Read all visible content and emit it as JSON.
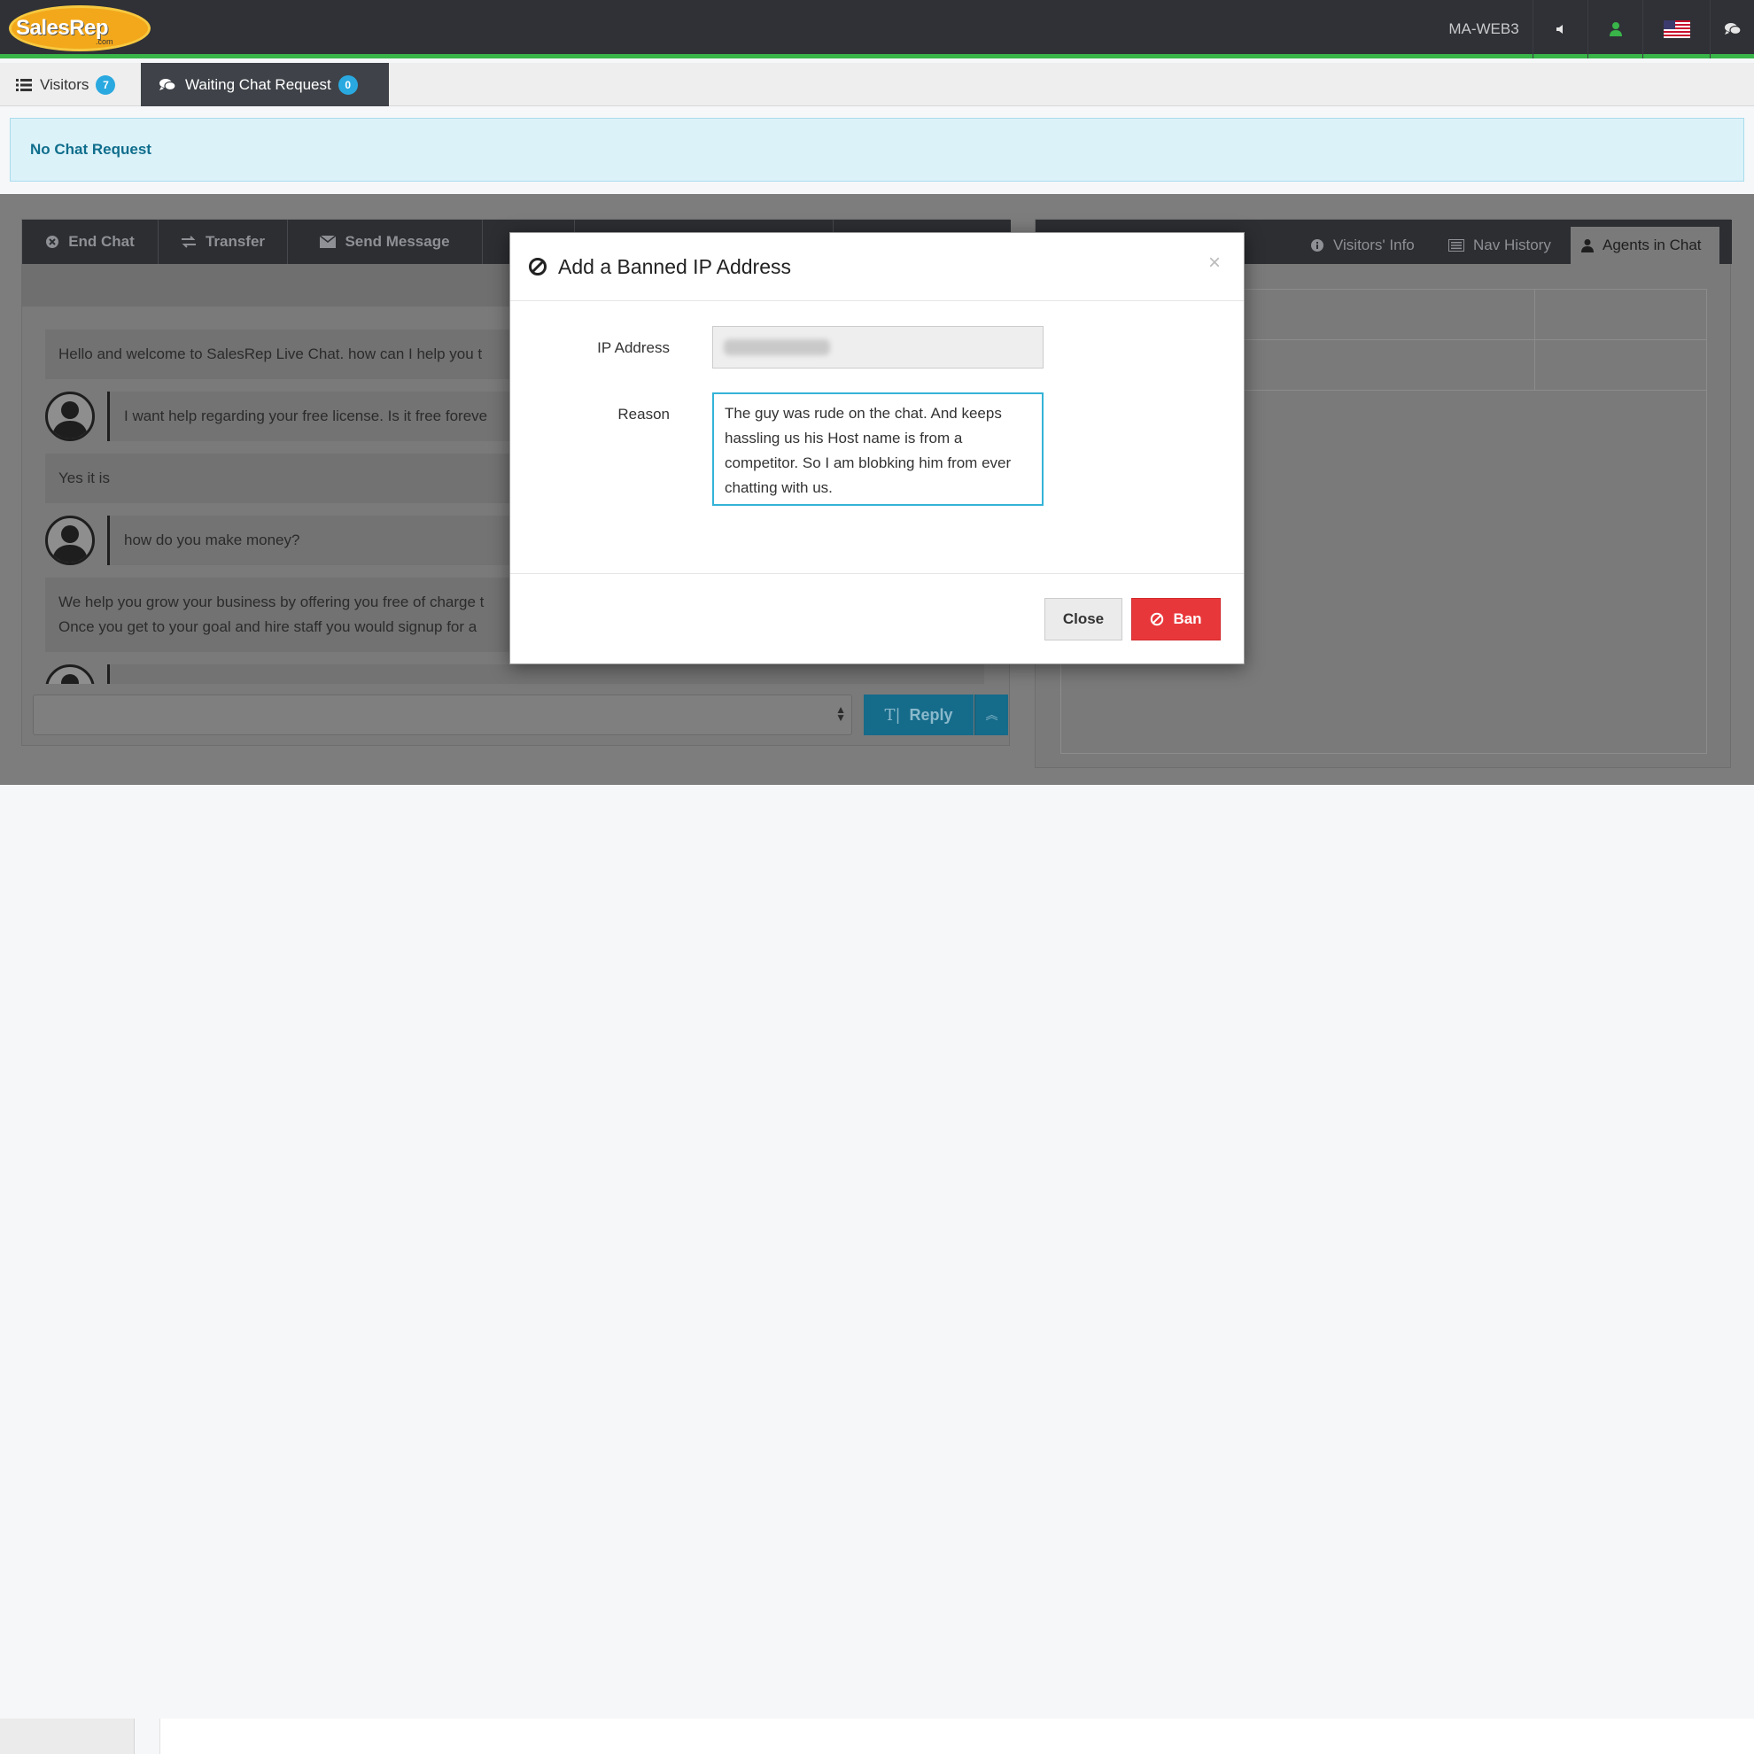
{
  "brand": {
    "logo_text": "SalesRep",
    "logo_sub": ".com"
  },
  "topbar": {
    "host": "MA-WEB3"
  },
  "tabs": {
    "visitors": {
      "label": "Visitors",
      "count": "7"
    },
    "waiting": {
      "label": "Waiting Chat Request",
      "count": "0"
    }
  },
  "alert": {
    "text": "No Chat Request"
  },
  "chat_toolbar": {
    "end_chat": "End Chat",
    "transfer": "Transfer",
    "send_message": "Send Message"
  },
  "messages": [
    {
      "from": "agent",
      "text": "Hello and welcome to SalesRep Live Chat. how can I help you t"
    },
    {
      "from": "visitor",
      "text": "I want help regarding your free license. Is it free foreve"
    },
    {
      "from": "agent",
      "text": "Yes it is"
    },
    {
      "from": "visitor",
      "text": "how do you make money?"
    },
    {
      "from": "agent",
      "text": "We help you grow your business by offering you free of charge t",
      "text2": "Once you get to your goal and hire staff you would signup for a"
    }
  ],
  "reply": {
    "label": "Reply"
  },
  "right_tabs": {
    "visitors_info": "Visitors' Info",
    "nav_history": "Nav History",
    "agents_in_chat": "Agents in Chat"
  },
  "modal": {
    "title": "Add a Banned IP Address",
    "ip_label": "IP Address",
    "reason_label": "Reason",
    "reason_value": "The guy was rude on the chat. And keeps hassling us his Host name is from a competitor. So I am blobking him from ever chatting with us.",
    "close_label": "Close",
    "ban_label": "Ban"
  },
  "colors": {
    "accent_green": "#39b54a",
    "badge_blue": "#29a9e0",
    "ban_red": "#e8373a",
    "focus_blue": "#34b3d7"
  }
}
